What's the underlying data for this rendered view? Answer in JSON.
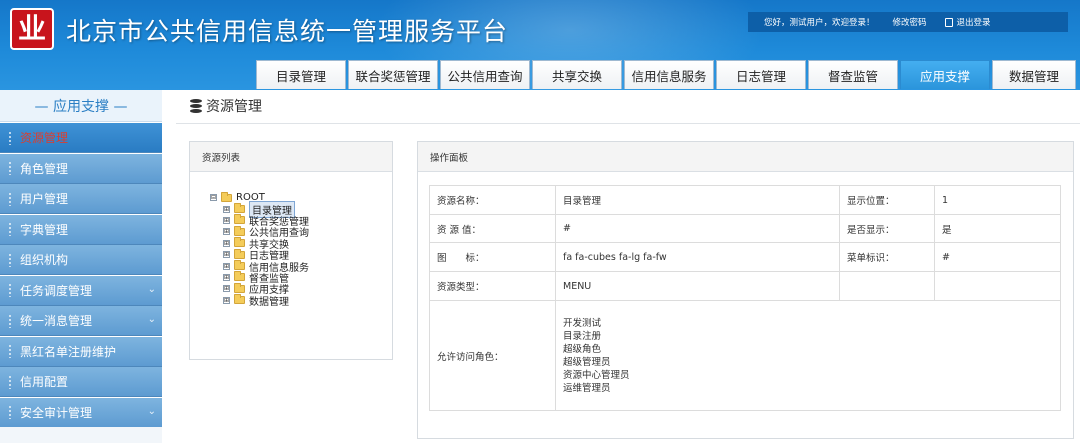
{
  "header": {
    "logo_text": "业",
    "title": "北京市公共信用信息统一管理服务平台",
    "greeting": "您好，测试用户，欢迎登录！",
    "change_password": "修改密码",
    "logout": "退出登录"
  },
  "nav": {
    "tabs": [
      "目录管理",
      "联合奖惩管理",
      "公共信用查询",
      "共享交换",
      "信用信息服务",
      "日志管理",
      "督查监管",
      "应用支撑",
      "数据管理"
    ],
    "active": "应用支撑"
  },
  "sidebar": {
    "heading": "— 应用支撑 —",
    "items": [
      {
        "label": "资源管理",
        "active": true,
        "expandable": false
      },
      {
        "label": "角色管理",
        "active": false,
        "expandable": false
      },
      {
        "label": "用户管理",
        "active": false,
        "expandable": false
      },
      {
        "label": "字典管理",
        "active": false,
        "expandable": false
      },
      {
        "label": "组织机构",
        "active": false,
        "expandable": false
      },
      {
        "label": "任务调度管理",
        "active": false,
        "expandable": true
      },
      {
        "label": "统一消息管理",
        "active": false,
        "expandable": true
      },
      {
        "label": "黑红名单注册维护",
        "active": false,
        "expandable": false
      },
      {
        "label": "信用配置",
        "active": false,
        "expandable": false
      },
      {
        "label": "安全审计管理",
        "active": false,
        "expandable": true
      }
    ]
  },
  "page": {
    "title": "资源管理"
  },
  "resource_panel": {
    "title": "资源列表",
    "root": "ROOT",
    "root_toggle": "⊟",
    "child_toggle": "⊞",
    "children": [
      "目录管理",
      "联合奖惩管理",
      "公共信用查询",
      "共享交换",
      "日志管理",
      "信用信息服务",
      "督查监管",
      "应用支撑",
      "数据管理"
    ],
    "selected": "目录管理"
  },
  "op_panel": {
    "title": "操作面板",
    "labels": {
      "name": "资源名称：",
      "value": "资 源 值：",
      "icon": "图　　标：",
      "type": "资源类型：",
      "roles": "允许访问角色：",
      "position": "显示位置：",
      "visible": "是否显示：",
      "menu_id": "菜单标识："
    },
    "values": {
      "name": "目录管理",
      "value": "#",
      "icon": "fa fa-cubes fa-lg fa-fw",
      "type": "MENU",
      "position": "1",
      "visible": "是",
      "menu_id": "#"
    },
    "roles": [
      "开发测试",
      "目录注册",
      "超级角色",
      "超级管理员",
      "资源中心管理员",
      "运维管理员"
    ]
  }
}
